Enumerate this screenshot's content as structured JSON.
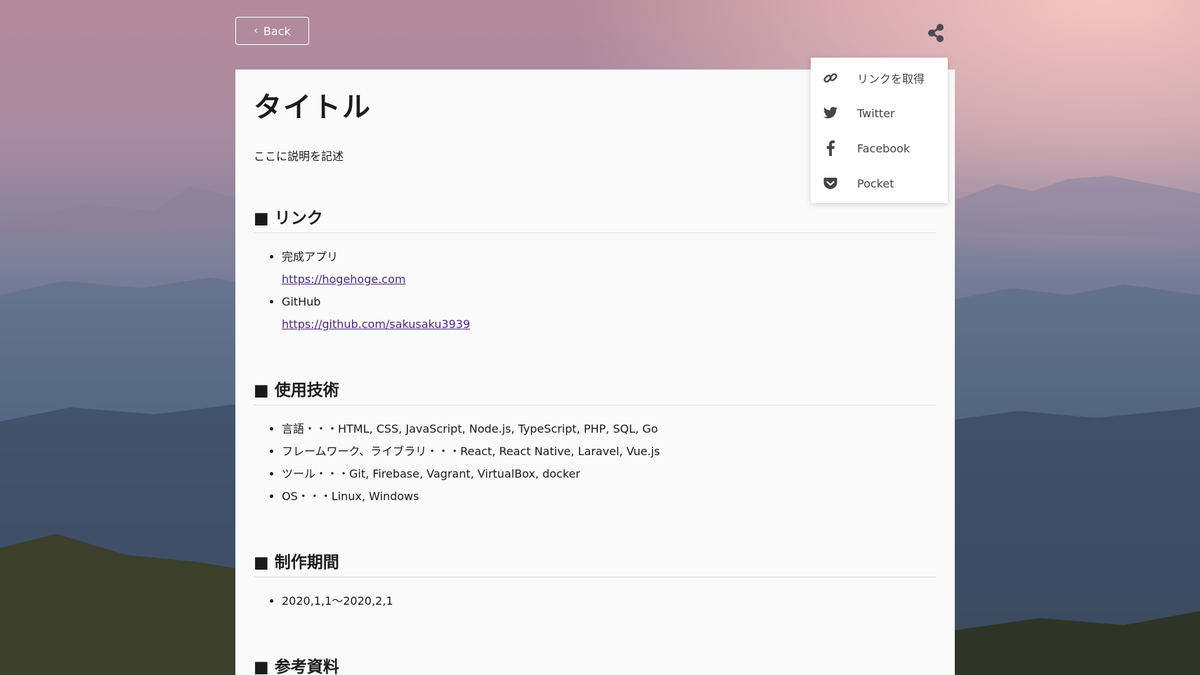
{
  "header": {
    "back_label": "Back"
  },
  "share_menu": {
    "items": [
      {
        "label": "リンクを取得",
        "icon": "link-icon"
      },
      {
        "label": "Twitter",
        "icon": "twitter-icon"
      },
      {
        "label": "Facebook",
        "icon": "facebook-icon"
      },
      {
        "label": "Pocket",
        "icon": "pocket-icon"
      }
    ]
  },
  "article": {
    "title": "タイトル",
    "description": "ここに説明を記述",
    "sections": {
      "links": {
        "heading": "■ リンク",
        "items": [
          {
            "label": "完成アプリ",
            "url": "https://hogehoge.com"
          },
          {
            "label": "GitHub",
            "url": "https://github.com/sakusaku3939"
          }
        ]
      },
      "tech": {
        "heading": "■ 使用技術",
        "items": [
          "言語・・・HTML, CSS, JavaScript, Node.js, TypeScript, PHP, SQL, Go",
          "フレームワーク、ライブラリ・・・React, React Native, Laravel, Vue.js",
          "ツール・・・Git, Firebase, Vagrant, VirtualBox, docker",
          "OS・・・Linux, Windows"
        ]
      },
      "period": {
        "heading": "■ 制作期間",
        "items": [
          "2020,1,1〜2020,2,1"
        ]
      },
      "references": {
        "heading": "■ 参考資料"
      }
    }
  },
  "colors": {
    "link": "#4c2a85",
    "panel_bg": "#fafafa",
    "icon": "#444444"
  }
}
